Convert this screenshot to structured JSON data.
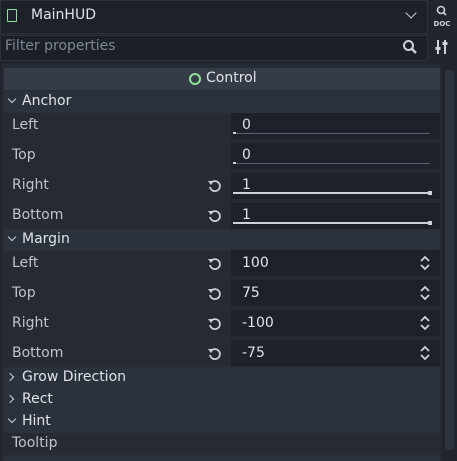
{
  "object_bar": {
    "name": "MainHUD"
  },
  "filter": {
    "placeholder": "Filter properties"
  },
  "section": {
    "title": "Control"
  },
  "groups": {
    "anchor": {
      "label": "Anchor"
    },
    "margin": {
      "label": "Margin"
    },
    "grow_direction": {
      "label": "Grow Direction"
    },
    "rect": {
      "label": "Rect"
    },
    "hint": {
      "label": "Hint"
    }
  },
  "anchor": {
    "left": {
      "label": "Left",
      "value": "0"
    },
    "top": {
      "label": "Top",
      "value": "0"
    },
    "right": {
      "label": "Right",
      "value": "1"
    },
    "bottom": {
      "label": "Bottom",
      "value": "1"
    }
  },
  "margin": {
    "left": {
      "label": "Left",
      "value": "100"
    },
    "top": {
      "label": "Top",
      "value": "75"
    },
    "right": {
      "label": "Right",
      "value": "-100"
    },
    "bottom": {
      "label": "Bottom",
      "value": "-75"
    }
  },
  "hint": {
    "tooltip": {
      "label": "Tooltip"
    }
  },
  "icons": {
    "node": "control-node-icon",
    "dropdown": "chevron-down-icon",
    "doc": "doc-search-icon",
    "search": "search-icon",
    "filter_settings": "tool-settings-icon",
    "revert": "revert-icon",
    "spin": "spinner-arrows-icon"
  },
  "colors": {
    "accent_green": "#8ee29a",
    "background": "#21262e",
    "field": "#1d2129"
  }
}
